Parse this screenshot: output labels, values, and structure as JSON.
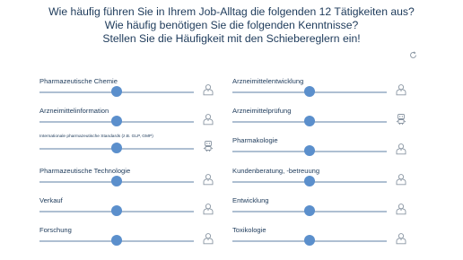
{
  "header": {
    "line1": "Wie häufig führen Sie in Ihrem Job-Alltag die folgenden 12 Tätigkeiten aus?",
    "line2": "Wie häufig benötigen Sie die folgenden Kenntnisse?",
    "line3": "Stellen Sie die Häufigkeit mit den Schiebereglern ein!"
  },
  "reset_icon": "refresh-icon",
  "colors": {
    "track": "#aebfd2",
    "thumb": "#5b8fcc",
    "text": "#1d3a5a"
  },
  "sliders": [
    {
      "label": "Pharmazeutische Chemie",
      "value": 0.5,
      "icon": "person-icon"
    },
    {
      "label": "Arzneimittelentwicklung",
      "value": 0.5,
      "icon": "person-icon"
    },
    {
      "label": "Arzneimittelinformation",
      "value": 0.5,
      "icon": "person-icon"
    },
    {
      "label": "Arzneimittelprüfung",
      "value": 0.5,
      "icon": "robot-icon"
    },
    {
      "label": "Internationale pharmazeutische Standards (z.B. GLP, GMP)",
      "value": 0.5,
      "icon": "robot-icon"
    },
    {
      "label": "Pharmakologie",
      "value": 0.5,
      "icon": "person-icon"
    },
    {
      "label": "Pharmazeutische Technologie",
      "value": 0.5,
      "icon": "person-icon"
    },
    {
      "label": "Kundenberatung, -betreuung",
      "value": 0.5,
      "icon": "person-icon"
    },
    {
      "label": "Verkauf",
      "value": 0.5,
      "icon": "person-icon"
    },
    {
      "label": "Entwicklung",
      "value": 0.5,
      "icon": "person-icon"
    },
    {
      "label": "Forschung",
      "value": 0.5,
      "icon": "person-icon"
    },
    {
      "label": "Toxikologie",
      "value": 0.5,
      "icon": "person-icon"
    }
  ]
}
